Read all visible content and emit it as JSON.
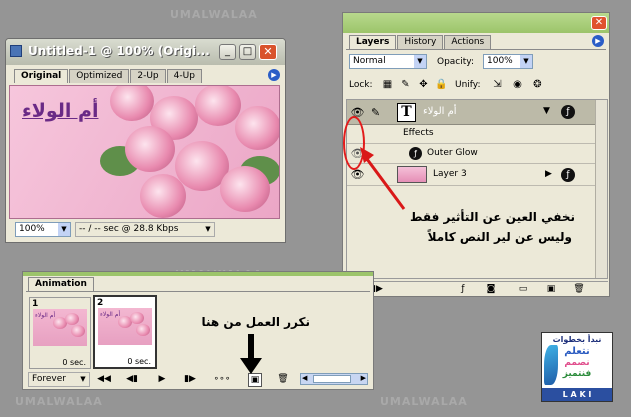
{
  "watermark": "UMALWALAA",
  "image_window": {
    "title": "Untitled-1 @ 100% (Origi...",
    "tabs": [
      "Original",
      "Optimized",
      "2-Up",
      "4-Up"
    ],
    "canvas_text": "أم الولاء",
    "zoom": "100%",
    "status": "-- / -- sec @ 28.8 Kbps"
  },
  "layers_panel": {
    "tabs": [
      "Layers",
      "History",
      "Actions"
    ],
    "blend_mode": "Normal",
    "opacity_label": "Opacity:",
    "opacity_value": "100%",
    "lock_label": "Lock:",
    "unify_label": "Unify:",
    "layers": [
      {
        "name": "أم الولاء",
        "kind": "text",
        "thumb": "T"
      },
      {
        "name": "Effects",
        "kind": "effects"
      },
      {
        "name": "Outer Glow",
        "kind": "effect"
      },
      {
        "name": "Layer 3",
        "kind": "image"
      }
    ]
  },
  "animation_panel": {
    "tab": "Animation",
    "frames": [
      {
        "num": "1",
        "delay": "0 sec.",
        "thumb_text": "أم الولاء"
      },
      {
        "num": "2",
        "delay": "0 sec.",
        "thumb_text": "أم الولاء"
      }
    ],
    "loop": "Forever"
  },
  "annotations": {
    "eye_note_line1": "نخفي العين عن التأثير فقط",
    "eye_note_line2": "وليس عن لير النص كاملاً",
    "repeat_note": "نكرر العمل من هنا"
  },
  "logo": {
    "line1": "نبدأ بخطوات",
    "line2": "نتعلم",
    "line3": "نصمم",
    "line4": "فنتميز",
    "footer": "L A K I"
  }
}
